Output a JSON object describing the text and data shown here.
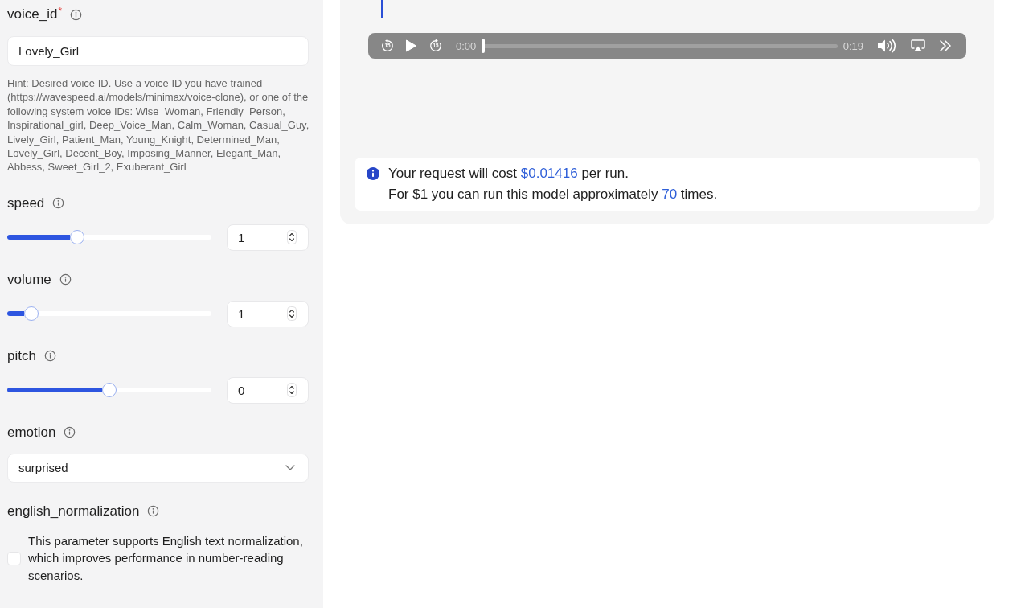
{
  "form": {
    "fields": [
      {
        "kind": "text",
        "label": "voice_id",
        "required_mark": "*",
        "value": "Lovely_Girl",
        "hint": "Hint: Desired voice ID. Use a voice ID you have trained (https://wavespeed.ai/models/minimax/voice-clone), or one of the following system voice IDs: Wise_Woman, Friendly_Person, Inspirational_girl, Deep_Voice_Man, Calm_Woman, Casual_Guy, Lively_Girl, Patient_Man, Young_Knight, Determined_Man, Lovely_Girl, Decent_Boy, Imposing_Manner, Elegant_Man, Abbess, Sweet_Girl_2, Exuberant_Girl"
      },
      {
        "kind": "slider",
        "label": "speed",
        "level": 0.33,
        "value": "1"
      },
      {
        "kind": "slider",
        "label": "volume",
        "level": 0.09,
        "value": "1"
      },
      {
        "kind": "slider",
        "label": "pitch",
        "level": 0.5,
        "value": "0"
      },
      {
        "kind": "select",
        "label": "emotion",
        "value": "surprised"
      },
      {
        "kind": "checkbox",
        "label": "english_normalization",
        "checked": false,
        "description": "This parameter supports English text normalization, which improves performance in number-reading scenarios."
      }
    ]
  },
  "output": {
    "player": {
      "skip_back": "15",
      "playing": false,
      "skip_forward": "15",
      "elapsed": "0:00",
      "level": 0,
      "duration": "0:19"
    },
    "cost_notice": {
      "lines": [
        {
          "parts": [
            {
              "text": "Your request will cost",
              "highlight": false
            },
            {
              "text": "$0.01416",
              "highlight": true
            },
            {
              "text": "per run.",
              "highlight": false
            }
          ]
        },
        {
          "parts": [
            {
              "text": "For $1 you can run this model approximately",
              "highlight": false
            },
            {
              "text": "70",
              "highlight": true
            },
            {
              "text": "times.",
              "highlight": false
            }
          ]
        }
      ]
    }
  }
}
